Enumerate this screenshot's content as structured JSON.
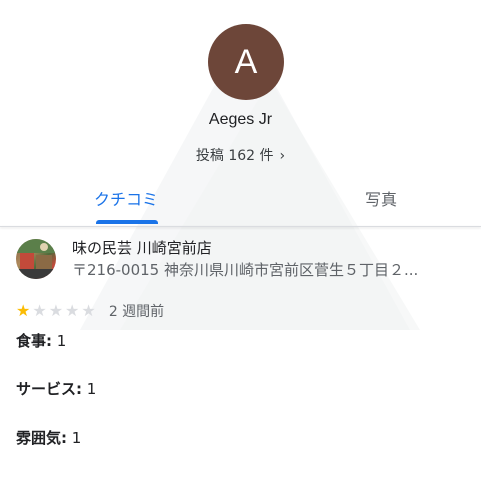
{
  "profile": {
    "avatar_letter": "A",
    "avatar_color": "#6d4639",
    "name": "Aeges Jr",
    "post_count": "投稿 162 件",
    "chevron": "›"
  },
  "tabs": [
    {
      "label": "クチコミ",
      "active": true
    },
    {
      "label": "写真",
      "active": false
    }
  ],
  "accent_color": "#1a73e8",
  "review": {
    "place_name": "味の民芸 川崎宮前店",
    "place_address": "〒216-0015 神奈川県川崎市宮前区菅生５丁目２...",
    "rating": 1,
    "rating_max": 5,
    "time_ago": "2 週間前",
    "details": [
      {
        "label": "食事:",
        "value": "1"
      },
      {
        "label": "サービス:",
        "value": "1"
      },
      {
        "label": "雰囲気:",
        "value": "1"
      }
    ]
  }
}
